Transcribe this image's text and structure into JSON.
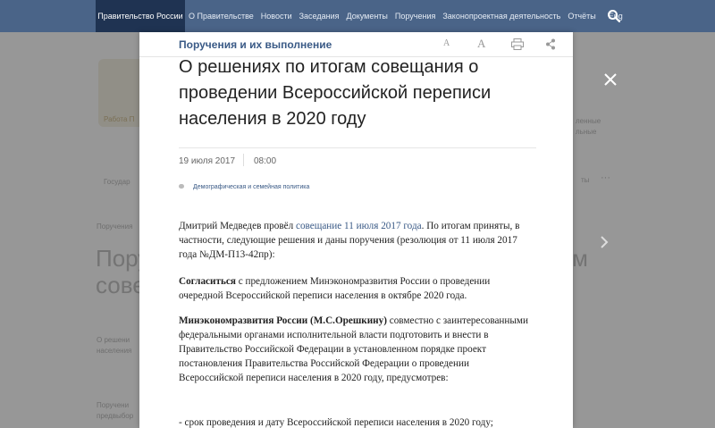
{
  "nav": {
    "home": "Правительство России",
    "links": [
      "О Правительстве",
      "Новости",
      "Заседания",
      "Документы",
      "Поручения",
      "Законопроектная деятельность",
      "Отчёты",
      "Eng"
    ]
  },
  "background": {
    "crest_caption": "Работа П",
    "item_right": "ленные",
    "item_right2": "льные",
    "left_label": "Государ",
    "breadcrumb": "Поручения",
    "big_left1": "Пору",
    "big_left2": "сове",
    "big_right": "м",
    "list1": "О решени",
    "list2": "населения",
    "list3": "Поручени",
    "list4": "предвыбор",
    "right_small": "ты",
    "right_dots": "···"
  },
  "modal": {
    "section": "Поручения и их выполнение",
    "font_small": "A",
    "font_large": "A",
    "title": "О решениях по итогам совещания о проведении Всероссийской переписи населения в 2020 году",
    "date": "19 июля 2017",
    "time": "08:00",
    "tag": "Демографическая и семейная политика",
    "p1_a": "Дмитрий Медведев провёл ",
    "p1_link": "совещание 11 июля 2017 года",
    "p1_b": ". По итогам приняты, в частности, следующие решения и даны поручения (резолюция от 11 июля 2017 года №ДМ-П13-42пр):",
    "p2_bold": "Согласиться",
    "p2_rest": " с предложением Минэкономразвития России о проведении очередной Всероссийской переписи населения в октябре 2020 года.",
    "p3_bold": "Минэкономразвития России (М.С.Орешкину)",
    "p3_rest": " совместно с заинтересованными федеральными органами исполнительной власти подготовить и внести в Правительство Российской Федерации в установленном порядке проект постановления Правительства Российской Федерации о проведении Всероссийской переписи населения в 2020 году, предусмотрев:",
    "p4": "- срок проведения и дату Всероссийской переписи населения в 2020 году;"
  }
}
